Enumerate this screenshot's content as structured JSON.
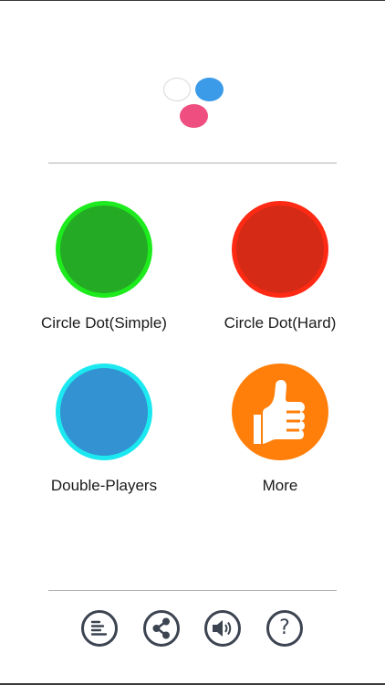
{
  "menu": {
    "modes": [
      {
        "label": "Circle Dot(Simple)"
      },
      {
        "label": "Circle Dot(Hard)"
      },
      {
        "label": "Double-Players"
      },
      {
        "label": "More"
      }
    ]
  },
  "toolbar": {
    "items": [
      {
        "icon": "list-icon"
      },
      {
        "icon": "share-icon"
      },
      {
        "icon": "speaker-icon"
      },
      {
        "icon": "help-icon",
        "glyph": "?"
      }
    ]
  },
  "colors": {
    "simple_fill": "#24aa24",
    "simple_ring": "#1eeb1e",
    "hard_fill": "#d42a16",
    "hard_ring": "#ff2a14",
    "double_fill": "#3292d2",
    "double_ring": "#1ce8f0",
    "more_fill": "#ff7f0a",
    "logo_blue": "#3b9be8",
    "logo_pink": "#ee4f80",
    "icon_stroke": "#3c4351"
  }
}
